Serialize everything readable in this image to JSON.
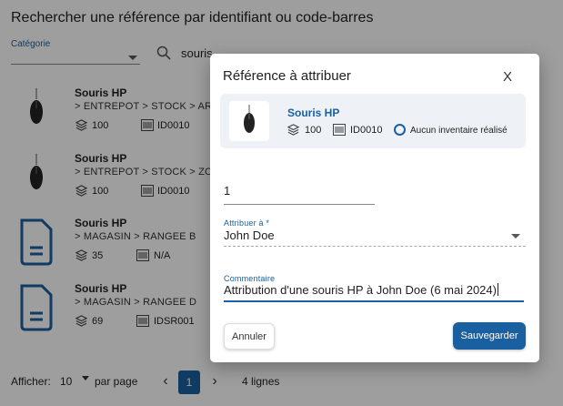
{
  "background": {
    "title": "Rechercher une référence par identifiant ou code-barres",
    "category_label": "Catégorie",
    "search_value": "souris",
    "items": [
      {
        "name": "Souris HP",
        "path": "> ENTREPOT  > STOCK  > AR",
        "qty": "100",
        "id": "ID0010",
        "type": "mouse"
      },
      {
        "name": "Souris HP",
        "path": "> ENTREPOT  > STOCK  > ZO",
        "qty": "100",
        "id": "ID0010",
        "type": "mouse"
      },
      {
        "name": "Souris HP",
        "path": "> MAGASIN  > RANGEE B",
        "qty": "35",
        "id": "N/A",
        "type": "document"
      },
      {
        "name": "Souris HP",
        "path": "> MAGASIN  > RANGEE D",
        "qty": "69",
        "id": "IDSR001",
        "type": "document"
      }
    ],
    "footer": {
      "show_label": "Afficher:",
      "page_size": "10",
      "per_page_label": "par page",
      "current_page": "1",
      "prev": "‹",
      "next": "›",
      "total": "4 lignes"
    }
  },
  "dialog": {
    "title": "Référence à attribuer",
    "close": "X",
    "reference": {
      "name": "Souris HP",
      "qty": "100",
      "id": "ID0010",
      "inventory_status": "Aucun inventaire réalisé"
    },
    "quantity_value": "1",
    "assign_label": "Attribuer à *",
    "assign_value": "John Doe",
    "comment_label": "Commentaire",
    "comment_value": "Attribution d'une souris HP à John Doe (6 mai 2024)",
    "cancel_label": "Annuler",
    "save_label": "Sauvegarder"
  },
  "colors": {
    "accent": "#1a5fa0",
    "overlay": "rgba(0,0,0,0.38)",
    "card_bg": "#eef2f7"
  }
}
